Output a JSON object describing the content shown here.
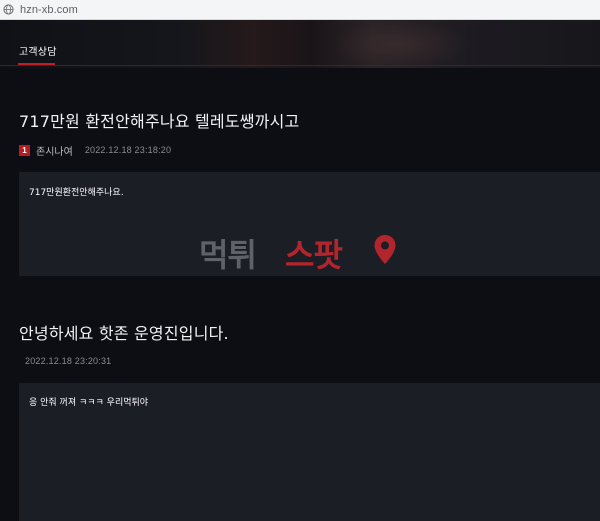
{
  "browser": {
    "url": "hzn-xb.com",
    "site_icon": "globe-icon"
  },
  "nav": {
    "active_tab": "고객상담",
    "accent_color": "#c11d24"
  },
  "post": {
    "title": "717만원 환전안해주나요 텔레도쌩까시고",
    "rank_badge": "1",
    "author": "존시나여",
    "datetime": "2022.12.18 23:18:20",
    "body": "717만원환전안해주나요."
  },
  "watermark": {
    "part1": "먹튀",
    "part2": "스팟",
    "icon": "location-pin-icon"
  },
  "reply": {
    "title": "안녕하세요 핫존 운영진입니다.",
    "datetime": "2022.12.18 23:20:31",
    "body": "응 안줘 꺼져 ㅋㅋㅋ 우리먹튀야"
  }
}
